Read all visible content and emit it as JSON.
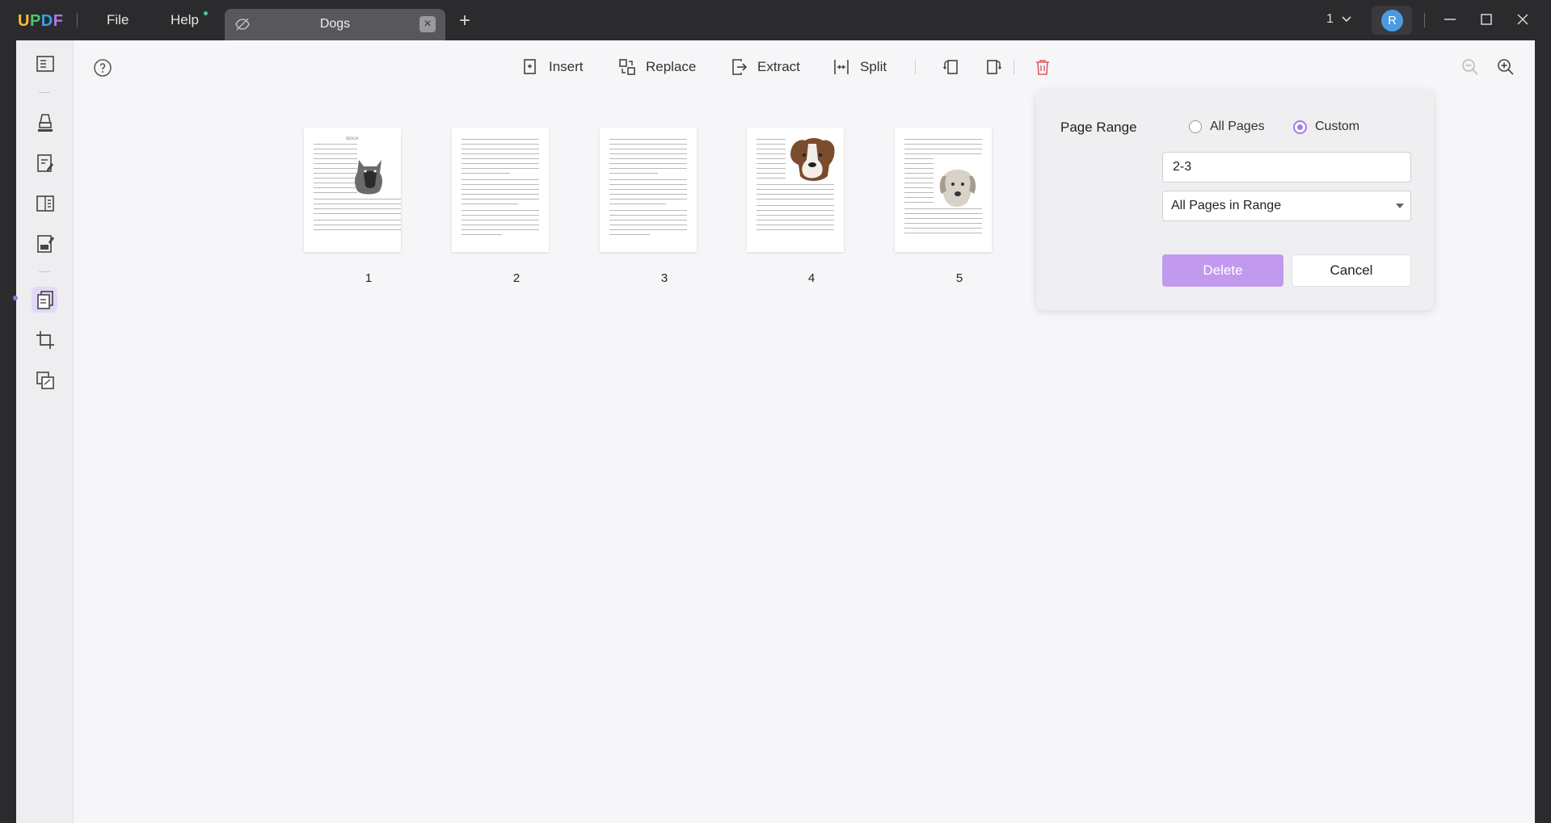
{
  "titlebar": {
    "logo_letters": [
      "U",
      "P",
      "D",
      "F"
    ],
    "menu_file": "File",
    "menu_help": "Help",
    "tab_title": "Dogs",
    "tab_close": "×",
    "new_tab": "+",
    "page_count": "1",
    "avatar_letter": "R",
    "accent": "#4a9be0"
  },
  "toolbar": {
    "insert": "Insert",
    "replace": "Replace",
    "extract": "Extract",
    "split": "Split"
  },
  "pages": [
    {
      "number": "1",
      "has_image": true,
      "title": "DOGS"
    },
    {
      "number": "2",
      "has_image": false
    },
    {
      "number": "3",
      "has_image": false
    },
    {
      "number": "4",
      "has_image": true
    },
    {
      "number": "5",
      "has_image": true
    }
  ],
  "delete_panel": {
    "title": "Page Range",
    "opt_all": "All Pages",
    "opt_custom": "Custom",
    "selected": "Custom",
    "range_value": "2-3",
    "subset_value": "All Pages in Range",
    "delete_label": "Delete",
    "cancel_label": "Cancel",
    "accent": "#a27be8"
  }
}
